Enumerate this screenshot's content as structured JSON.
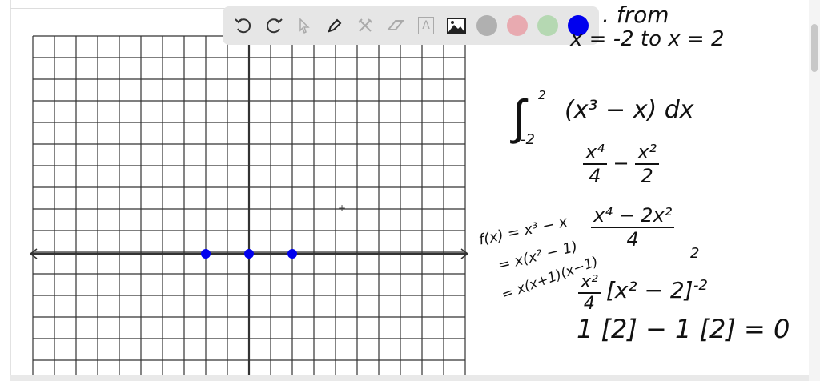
{
  "toolbar": {
    "tools": [
      {
        "name": "undo",
        "icon": "undo-icon",
        "enabled": true
      },
      {
        "name": "redo",
        "icon": "redo-icon",
        "enabled": true
      },
      {
        "name": "select",
        "icon": "pointer-icon",
        "enabled": false
      },
      {
        "name": "pen",
        "icon": "pen-icon",
        "enabled": true
      },
      {
        "name": "tools",
        "icon": "tools-icon",
        "enabled": false
      },
      {
        "name": "eraser",
        "icon": "eraser-icon",
        "enabled": false
      },
      {
        "name": "text",
        "icon": "text-box-icon",
        "enabled": false
      },
      {
        "name": "image",
        "icon": "image-icon",
        "enabled": true
      }
    ],
    "text_tool_glyph": "A",
    "colors": [
      "#b0b0b0",
      "#e8aab0",
      "#b5d8b2",
      "#0000ee"
    ],
    "selected_color": "#0000ee"
  },
  "graph": {
    "x_range": [
      -10,
      10
    ],
    "points_x": [
      -2,
      0,
      2
    ],
    "point_color": "#0000ee"
  },
  "notes": {
    "line1": ". from",
    "line2": "x = -2 to x = 2",
    "integral_upper": "2",
    "integral_lower": "-2",
    "integrand": "(x³ − x) dx",
    "antideriv_a_num": "x⁴",
    "antideriv_a_den": "4",
    "minus": "−",
    "antideriv_b_num": "x²",
    "antideriv_b_den": "2",
    "combined_num": "x⁴ − 2x²",
    "combined_den": "4",
    "factored_num": "x²",
    "factored_den": "4",
    "bracket_expr": "[x² − 2]",
    "bracket_upper": "2",
    "bracket_lower": "-2",
    "result": "1 [2] − 1 [2] = 0",
    "f1": "f(x) = x³ − x",
    "f2": "= x(x² − 1)",
    "f3": "= x(x+1)(x−1)"
  }
}
